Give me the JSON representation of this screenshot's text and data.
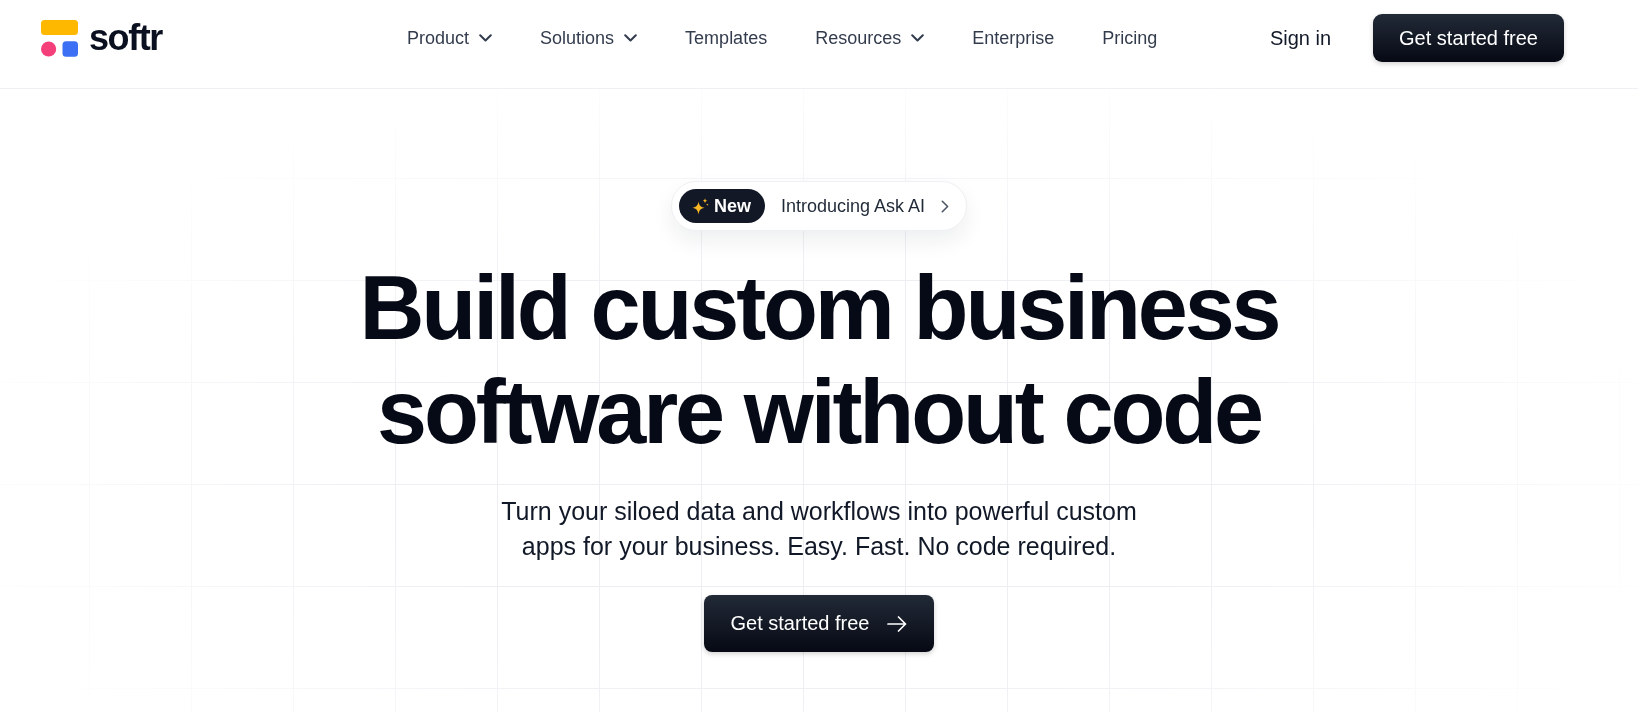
{
  "header": {
    "logo": {
      "wordmark": "softr"
    },
    "nav": [
      {
        "label": "Product",
        "has_menu": true
      },
      {
        "label": "Solutions",
        "has_menu": true
      },
      {
        "label": "Templates",
        "has_menu": false
      },
      {
        "label": "Resources",
        "has_menu": true
      },
      {
        "label": "Enterprise",
        "has_menu": false
      },
      {
        "label": "Pricing",
        "has_menu": false
      }
    ],
    "sign_in": "Sign in",
    "cta": "Get started free"
  },
  "hero": {
    "announcement": {
      "tag": "New",
      "text": "Introducing Ask AI"
    },
    "headline": "Build custom business software without code",
    "subtitle": "Turn your siloed data and workflows into powerful custom apps for your business. Easy. Fast. No code required.",
    "cta": "Get started free"
  }
}
